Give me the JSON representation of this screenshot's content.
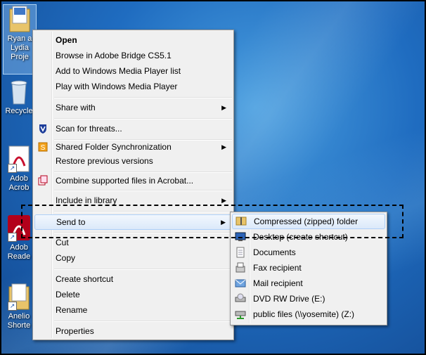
{
  "desktop": {
    "icons": [
      {
        "label": "Ryan a\nLydia\nProje"
      },
      {
        "label": "Recycle"
      },
      {
        "label": "Adob\nAcrob"
      },
      {
        "label": "Adob\nReade"
      },
      {
        "label": "Anelio\nShorte"
      }
    ]
  },
  "context_menu": {
    "items": [
      {
        "label": "Open"
      },
      {
        "label": "Browse in Adobe Bridge CS5.1"
      },
      {
        "label": "Add to Windows Media Player list"
      },
      {
        "label": "Play with Windows Media Player"
      },
      {
        "label": "Share with"
      },
      {
        "label": "Scan for threats..."
      },
      {
        "label": "Shared Folder Synchronization"
      },
      {
        "label": "Restore previous versions"
      },
      {
        "label": "Combine supported files in Acrobat..."
      },
      {
        "label": "Include in library"
      },
      {
        "label": "Send to"
      },
      {
        "label": "Cut"
      },
      {
        "label": "Copy"
      },
      {
        "label": "Create shortcut"
      },
      {
        "label": "Delete"
      },
      {
        "label": "Rename"
      },
      {
        "label": "Properties"
      }
    ],
    "submenu_arrow": "▶"
  },
  "send_to_menu": {
    "items": [
      {
        "label": "Compressed (zipped) folder"
      },
      {
        "label": "Desktop (create shortcut)"
      },
      {
        "label": "Documents"
      },
      {
        "label": "Fax recipient"
      },
      {
        "label": "Mail recipient"
      },
      {
        "label": "DVD RW Drive (E:)"
      },
      {
        "label": "public files (\\\\yosemite) (Z:)"
      }
    ]
  }
}
